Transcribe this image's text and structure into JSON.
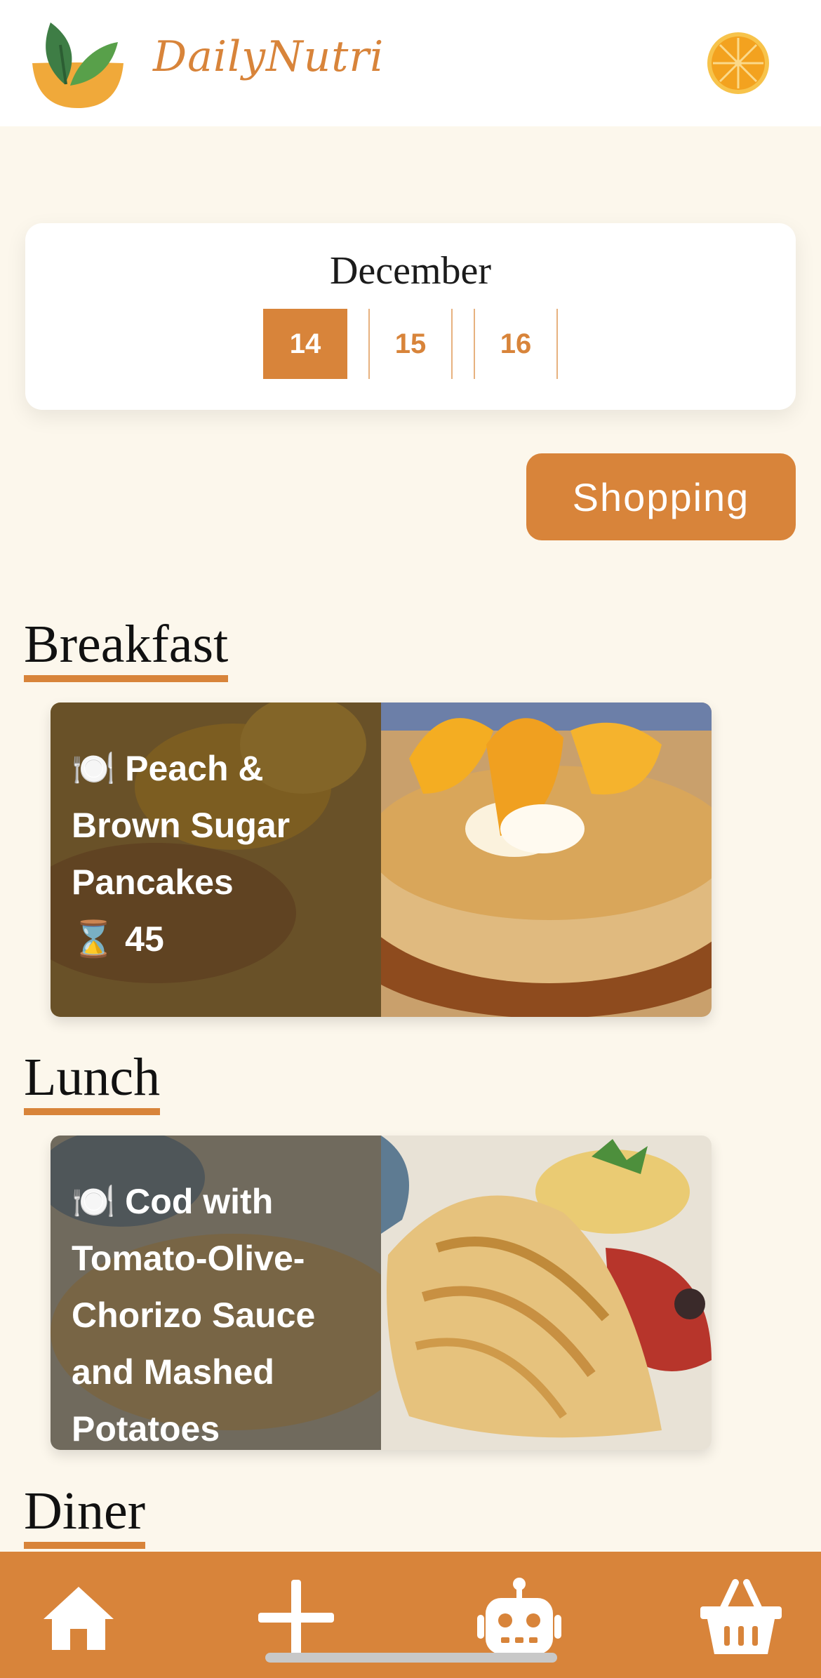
{
  "header": {
    "brand": "DailyNutri",
    "logo_icon": "leaf-bowl-icon",
    "avatar_icon": "orange-slice-icon"
  },
  "calendar": {
    "month": "December",
    "days": [
      "14",
      "15",
      "16"
    ],
    "selected_day": "14"
  },
  "actions": {
    "shopping_label": "Shopping"
  },
  "meals": {
    "breakfast": {
      "title": "Breakfast",
      "recipe_name": "Peach & Brown Sugar Pancakes",
      "time": "45",
      "plate_icon": "🍽️",
      "timer_icon": "⌛"
    },
    "lunch": {
      "title": "Lunch",
      "recipe_name": "Cod with Tomato-Olive-Chorizo Sauce and Mashed Potatoes",
      "plate_icon": "🍽️"
    },
    "diner": {
      "title": "Diner"
    }
  },
  "nav": {
    "items": [
      "home-icon",
      "plus-icon",
      "robot-icon",
      "basket-icon"
    ]
  },
  "colors": {
    "accent": "#d8843a",
    "background": "#fcf7ec",
    "card": "#ffffff"
  }
}
